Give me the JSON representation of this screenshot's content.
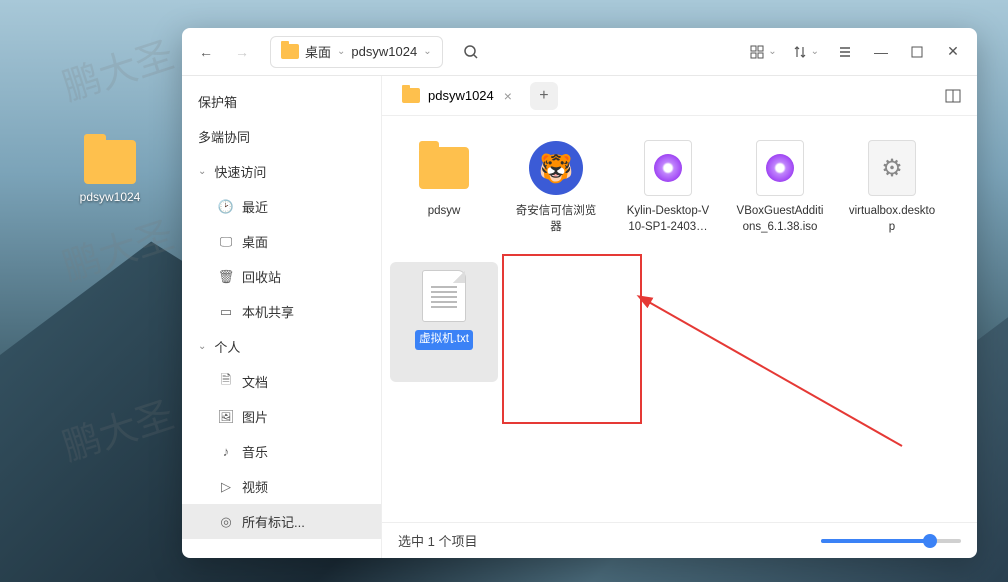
{
  "desktop": {
    "folder_label": "pdsyw1024"
  },
  "breadcrumb": {
    "part1": "桌面",
    "part2": "pdsyw1024"
  },
  "sidebar": {
    "baohu": "保护箱",
    "duoduan": "多端协同",
    "quick_header": "快速访问",
    "recent": "最近",
    "desktop": "桌面",
    "trash": "回收站",
    "share": "本机共享",
    "personal_header": "个人",
    "docs": "文档",
    "pics": "图片",
    "music": "音乐",
    "video": "视频",
    "tags": "所有标记..."
  },
  "tabs": {
    "tab1": "pdsyw1024",
    "close": "×",
    "new": "+"
  },
  "files": {
    "f1": "pdsyw",
    "f2": "奇安信可信浏览器",
    "f3": "Kylin-Desktop-V10-SP1-2403…",
    "f4": "VBoxGuestAdditions_6.1.38.iso",
    "f5": "virtualbox.desktop",
    "f6": "虚拟机.txt"
  },
  "status": {
    "text": "选中 1 个项目"
  },
  "watermark": "鹏大圣"
}
